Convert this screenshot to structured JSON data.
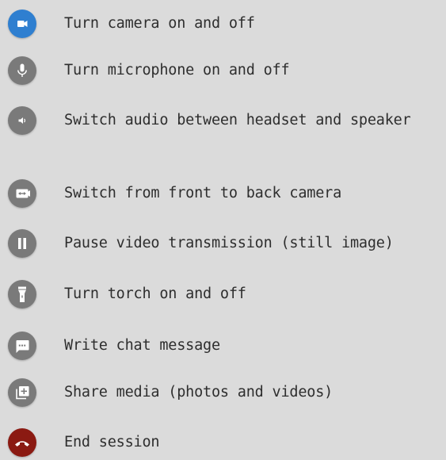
{
  "legend": {
    "items": [
      {
        "icon": "camera-icon",
        "label": "Turn camera on and off"
      },
      {
        "icon": "microphone-icon",
        "label": "Turn microphone on and off"
      },
      {
        "icon": "speaker-icon",
        "label": "Switch audio between headset and speaker"
      },
      {
        "icon": "switch-camera-icon",
        "label": "Switch from front to back camera"
      },
      {
        "icon": "pause-icon",
        "label": "Pause video transmission (still image)"
      },
      {
        "icon": "torch-icon",
        "label": "Turn torch on and off"
      },
      {
        "icon": "chat-icon",
        "label": "Write chat message"
      },
      {
        "icon": "share-media-icon",
        "label": "Share media (photos and videos)"
      },
      {
        "icon": "end-call-icon",
        "label": "End session"
      }
    ]
  },
  "colors": {
    "background": "#dbdbdb",
    "camera_button": "#2f7fd0",
    "default_button": "#7a7a7a",
    "end_button": "#8b1a12",
    "text": "#2e2e2e"
  }
}
